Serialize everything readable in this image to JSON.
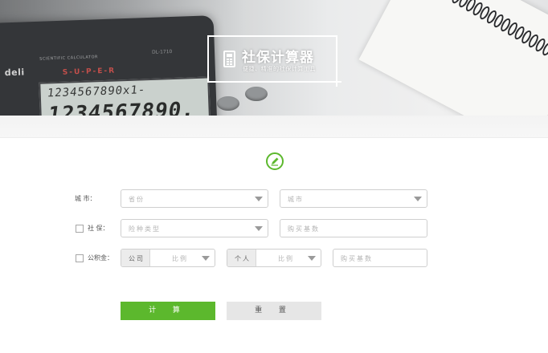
{
  "banner": {
    "title": "社保计算器",
    "subtitle": "便捷、精准的社保计算工具",
    "calculator_brand": "deli",
    "calculator_label": "SCIENTIFIC CALCULATOR",
    "calculator_model": "DL-1710",
    "calculator_super": "S-U-P-E-R",
    "display_line1": "1234567890x1-",
    "display_line2": "1234567890."
  },
  "form": {
    "city_row": {
      "label": "城    市：",
      "province_placeholder": "省份",
      "city_placeholder": "城市"
    },
    "social_row": {
      "label": "社  保：",
      "type_placeholder": "险种类型",
      "base_placeholder": "购买基数"
    },
    "fund_row": {
      "label": "公积金：",
      "company_label": "公司",
      "company_ratio_placeholder": "比例",
      "personal_label": "个人",
      "personal_ratio_placeholder": "比例",
      "base_placeholder": "购买基数"
    }
  },
  "buttons": {
    "calculate": "计 算",
    "reset": "重 置"
  },
  "colors": {
    "accent": "#5cb82d",
    "reset_bg": "#e6e6e6",
    "border": "#cfcfcf",
    "placeholder": "#b5b5b5"
  }
}
